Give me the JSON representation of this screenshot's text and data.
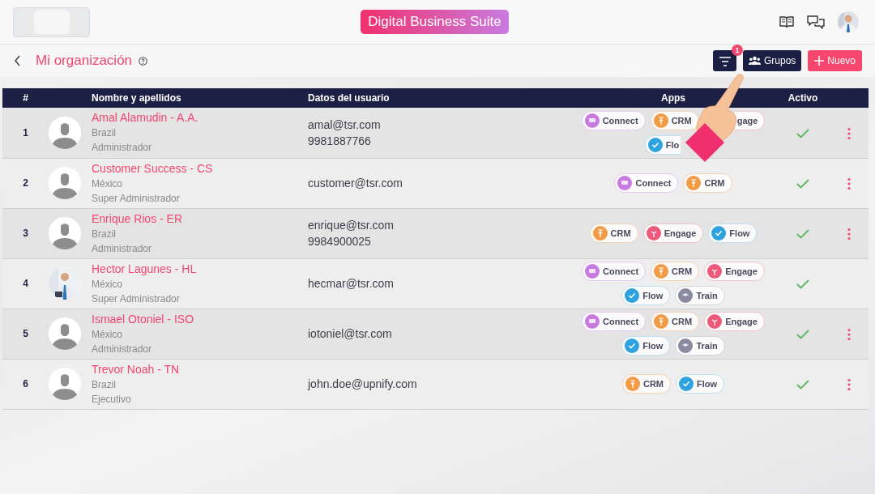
{
  "header": {
    "brand": "Digital Business Suite"
  },
  "toolbar": {
    "title": "Mi organización",
    "filter_badge": "1",
    "buttons": [
      {
        "label": "Grupos",
        "kind": "groups"
      },
      {
        "label": "Nuevo",
        "kind": "new"
      }
    ]
  },
  "table": {
    "columns": [
      "#",
      "Nombre y apellidos",
      "Datos del usuario",
      "Apps",
      "Activo"
    ],
    "rows": [
      {
        "index": "1",
        "avatar": {
          "kind": "silhouette"
        },
        "name": "Amal Alamudin - A.A.",
        "country": "Brazil",
        "role": "Administrador",
        "contact": [
          "amal@tsr.com",
          "9981887766"
        ],
        "apps": [
          {
            "label": "Connect",
            "kind": "connect"
          },
          {
            "label": "CRM",
            "kind": "crm"
          },
          {
            "label": "gage",
            "kind": "engage",
            "cut_start": true
          },
          {
            "label": "Flo",
            "kind": "flow",
            "cut_end": true
          }
        ],
        "active": true,
        "menu": true
      },
      {
        "index": "2",
        "avatar": {
          "kind": "silhouette"
        },
        "name": "Customer Success - CS",
        "country": "México",
        "role": "Super Administrador",
        "contact": [
          "customer@tsr.com"
        ],
        "apps": [
          {
            "label": "Connect",
            "kind": "connect"
          },
          {
            "label": "CRM",
            "kind": "crm"
          }
        ],
        "active": true,
        "menu": true
      },
      {
        "index": "3",
        "avatar": {
          "kind": "silhouette"
        },
        "name": "Enrique Rios - ER",
        "country": "Brazil",
        "role": "Administrador",
        "contact": [
          "enrique@tsr.com",
          "9984900025"
        ],
        "apps": [
          {
            "label": "CRM",
            "kind": "crm"
          },
          {
            "label": "Engage",
            "kind": "engage"
          },
          {
            "label": "Flow",
            "kind": "flow"
          }
        ],
        "active": true,
        "menu": true
      },
      {
        "index": "4",
        "avatar": {
          "kind": "picture"
        },
        "name": "Hector Lagunes - HL",
        "country": "México",
        "role": "Super Administrador",
        "contact": [
          "hecmar@tsr.com"
        ],
        "apps": [
          {
            "label": "Connect",
            "kind": "connect"
          },
          {
            "label": "CRM",
            "kind": "crm"
          },
          {
            "label": "Engage",
            "kind": "engage"
          },
          {
            "label": "Flow",
            "kind": "flow"
          },
          {
            "label": "Train",
            "kind": "train"
          }
        ],
        "active": true,
        "menu": false
      },
      {
        "index": "5",
        "avatar": {
          "kind": "silhouette"
        },
        "name": "Ismael Otoniel - ISO",
        "country": "México",
        "role": "Administrador",
        "contact": [
          "iotoniel@tsr.com"
        ],
        "apps": [
          {
            "label": "Connect",
            "kind": "connect"
          },
          {
            "label": "CRM",
            "kind": "crm"
          },
          {
            "label": "Engage",
            "kind": "engage"
          },
          {
            "label": "Flow",
            "kind": "flow"
          },
          {
            "label": "Train",
            "kind": "train"
          }
        ],
        "active": true,
        "menu": true
      },
      {
        "index": "6",
        "avatar": {
          "kind": "silhouette"
        },
        "name": "Trevor Noah - TN",
        "country": "Brazil",
        "role": "Ejecutivo",
        "contact": [
          "john.doe@upnify.com"
        ],
        "apps": [
          {
            "label": "CRM",
            "kind": "crm"
          },
          {
            "label": "Flow",
            "kind": "flow"
          }
        ],
        "active": true,
        "menu": true
      }
    ]
  }
}
